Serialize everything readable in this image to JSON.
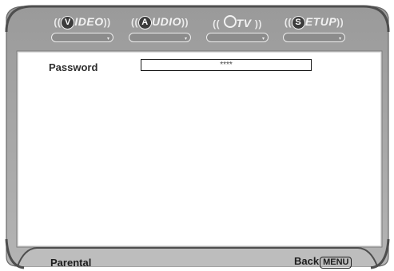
{
  "tabs": [
    {
      "letter": "V",
      "rest": "IDEO",
      "icon": "video-badge-icon"
    },
    {
      "letter": "A",
      "rest": "UDIO",
      "icon": "audio-badge-icon"
    },
    {
      "letter": "",
      "rest": "TV",
      "icon": "tv-ring-icon"
    },
    {
      "letter": "S",
      "rest": "ETUP",
      "icon": "setup-badge-icon"
    }
  ],
  "arrows": {
    "left": "((",
    "right": "))"
  },
  "password": {
    "label": "Password",
    "value": "****"
  },
  "footer": {
    "section": "Parental",
    "back_label": "Back",
    "menu_key": "MENU"
  },
  "colors": {
    "frame": "#a3a3a3",
    "frame_dark": "#5a5a5a",
    "panel": "#ffffff",
    "text": "#2e2e2e"
  }
}
